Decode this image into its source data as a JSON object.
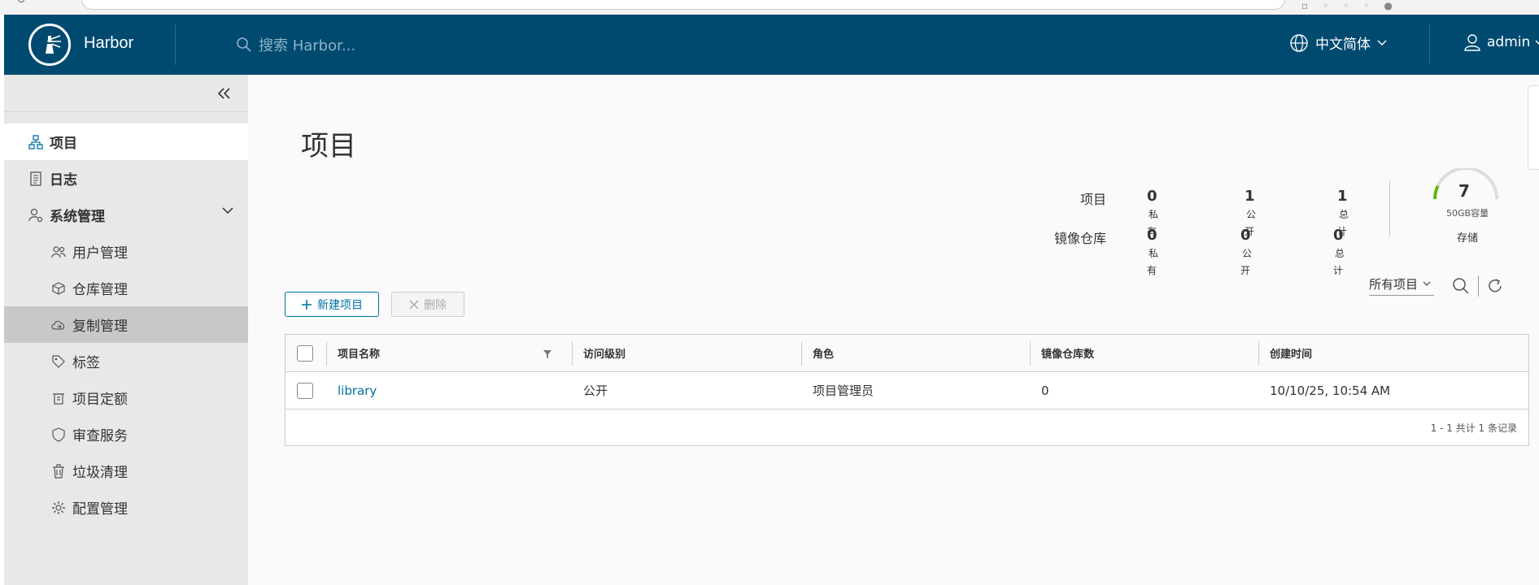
{
  "header": {
    "brand": "Harbor",
    "search_placeholder": "搜索 Harbor...",
    "language": "中文简体",
    "user": "admin"
  },
  "sidebar": {
    "items": [
      {
        "label": "项目",
        "icon": "projects-icon"
      },
      {
        "label": "日志",
        "icon": "logs-icon"
      },
      {
        "label": "系统管理",
        "icon": "admin-icon"
      },
      {
        "label": "用户管理",
        "icon": "users-icon"
      },
      {
        "label": "仓库管理",
        "icon": "registry-icon"
      },
      {
        "label": "复制管理",
        "icon": "replication-icon"
      },
      {
        "label": "标签",
        "icon": "tag-icon"
      },
      {
        "label": "项目定额",
        "icon": "quota-icon"
      },
      {
        "label": "审查服务",
        "icon": "shield-icon"
      },
      {
        "label": "垃圾清理",
        "icon": "trash-icon"
      },
      {
        "label": "配置管理",
        "icon": "gear-icon"
      }
    ]
  },
  "main": {
    "title": "项目",
    "stats": {
      "projects_label": "项目",
      "repos_label": "镜像仓库",
      "project_private": "0",
      "project_public": "1",
      "project_total": "1",
      "repo_private": "0",
      "repo_public": "0",
      "repo_total": "0",
      "private_unit": "私有",
      "public_unit": "公开",
      "total_unit": "总计",
      "storage_value": "7",
      "storage_caption": "50GB容量",
      "storage_label": "存储",
      "storage_used_fraction": 0.14
    },
    "buttons": {
      "new_project": "新建项目",
      "delete": "删除"
    },
    "filter": {
      "selected": "所有项目"
    },
    "table": {
      "columns": [
        "项目名称",
        "访问级别",
        "角色",
        "镜像仓库数",
        "创建时间"
      ],
      "rows": [
        {
          "name": "library",
          "access": "公开",
          "role": "项目管理员",
          "repo_count": "0",
          "created": "10/10/25, 10:54 AM"
        }
      ],
      "footer": "1 - 1 共计 1 条记录"
    }
  },
  "colors": {
    "header_bg": "#004a70",
    "accent": "#0072a3"
  }
}
